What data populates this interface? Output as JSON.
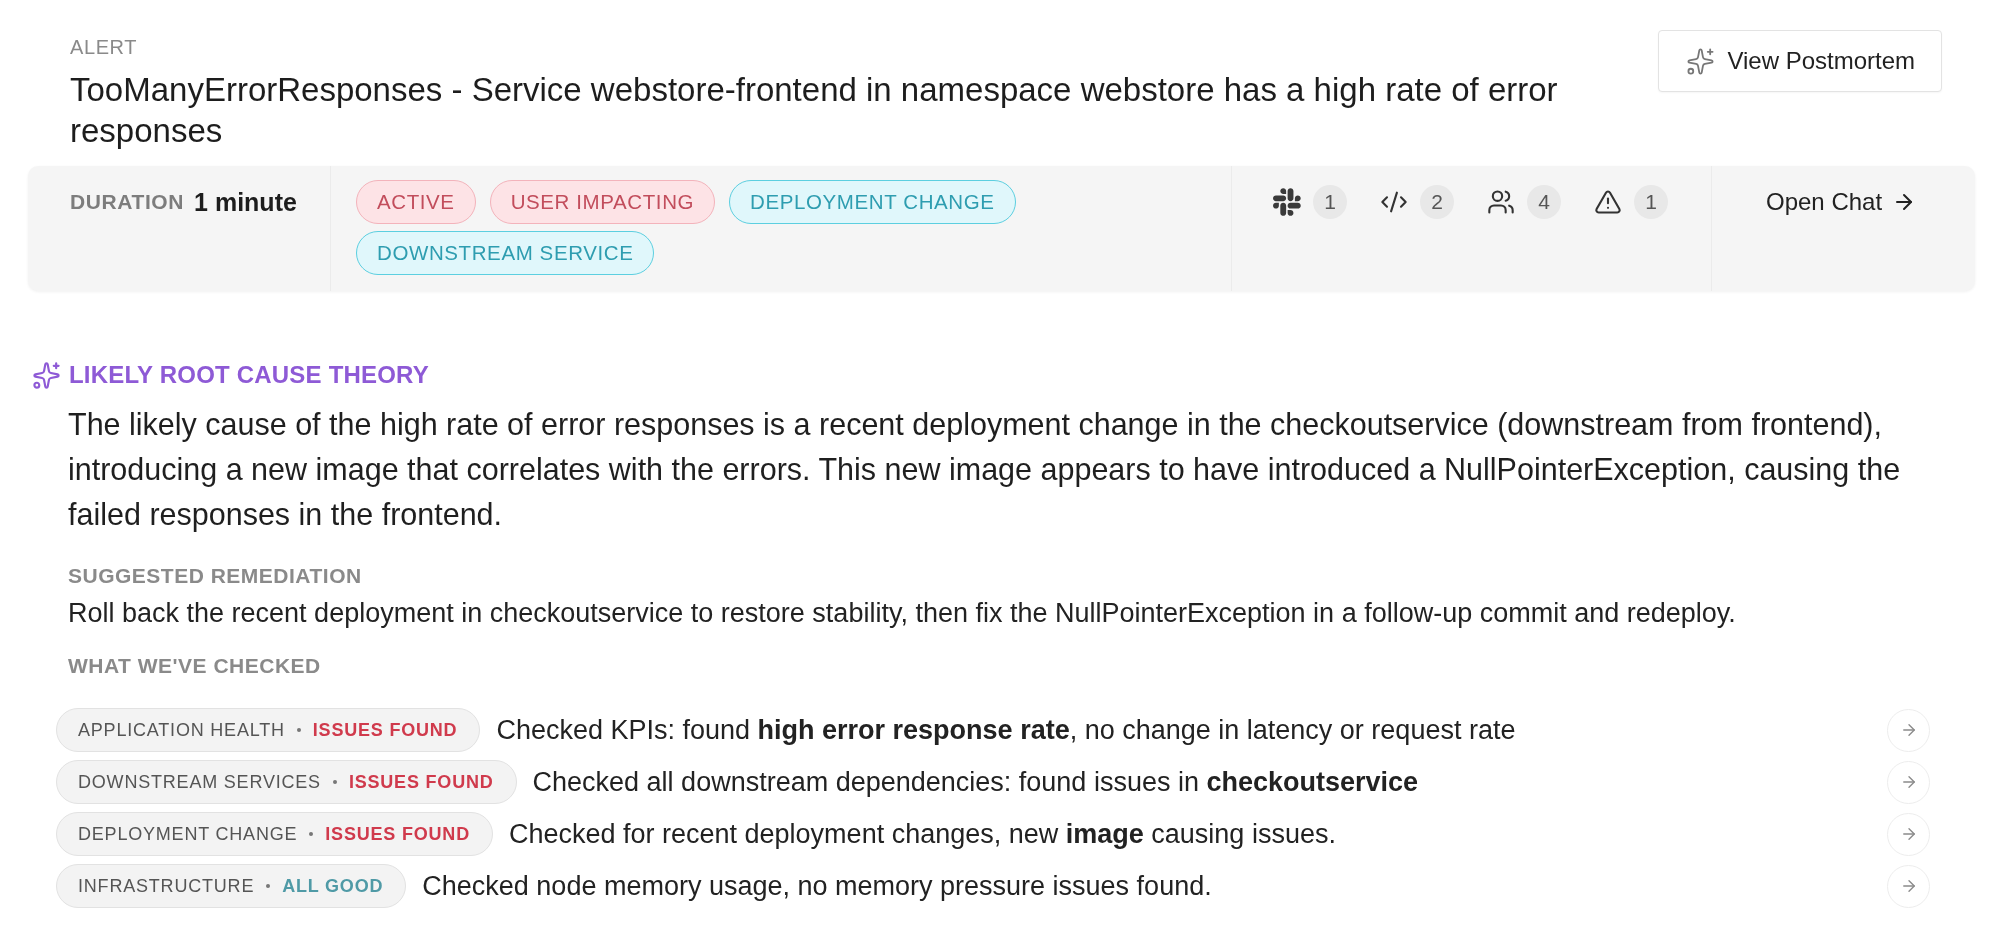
{
  "alert": {
    "label": "ALERT",
    "title": "TooManyErrorResponses - Service webstore-frontend in namespace webstore has a high rate of error responses"
  },
  "postmortem_button": {
    "label": "View Postmortem"
  },
  "summary_bar": {
    "duration_label": "DURATION",
    "duration_value": "1 minute",
    "tags": [
      {
        "label": "ACTIVE",
        "kind": "alert"
      },
      {
        "label": "USER IMPACTING",
        "kind": "alert"
      },
      {
        "label": "DEPLOYMENT CHANGE",
        "kind": "info"
      },
      {
        "label": "DOWNSTREAM SERVICE",
        "kind": "info"
      }
    ],
    "counters": [
      {
        "kind": "chat",
        "count": "1"
      },
      {
        "kind": "code",
        "count": "2"
      },
      {
        "kind": "people",
        "count": "4"
      },
      {
        "kind": "warning",
        "count": "1"
      }
    ],
    "open_chat": {
      "label": "Open Chat"
    }
  },
  "root_cause": {
    "heading": "LIKELY ROOT CAUSE THEORY",
    "text": "The likely cause of the high rate of error responses is a recent deployment change in the checkoutservice (downstream from frontend), introducing a new image that correlates with the errors. This new image appears to have introduced a NullPointerException, causing the failed responses in the frontend.",
    "remediation_heading": "SUGGESTED REMEDIATION",
    "remediation": "Roll back the recent deployment in checkoutservice to restore stability, then fix the NullPointerException in a follow-up commit and redeploy.",
    "checked_heading": "WHAT WE'VE CHECKED",
    "checks": [
      {
        "category": "APPLICATION HEALTH",
        "status": "ISSUES FOUND",
        "kind": "issue",
        "summary": "Checked KPIs: found **high error response rate**, no change in latency or request rate"
      },
      {
        "category": "DOWNSTREAM SERVICES",
        "status": "ISSUES FOUND",
        "kind": "issue",
        "summary": "Checked all downstream dependencies: found issues in **checkoutservice**"
      },
      {
        "category": "DEPLOYMENT CHANGE",
        "status": "ISSUES FOUND",
        "kind": "issue",
        "summary": "Checked for recent deployment changes, new **image** causing issues."
      },
      {
        "category": "INFRASTRUCTURE",
        "status": "ALL GOOD",
        "kind": "ok",
        "summary": "Checked node memory usage, no memory pressure issues found."
      }
    ]
  }
}
